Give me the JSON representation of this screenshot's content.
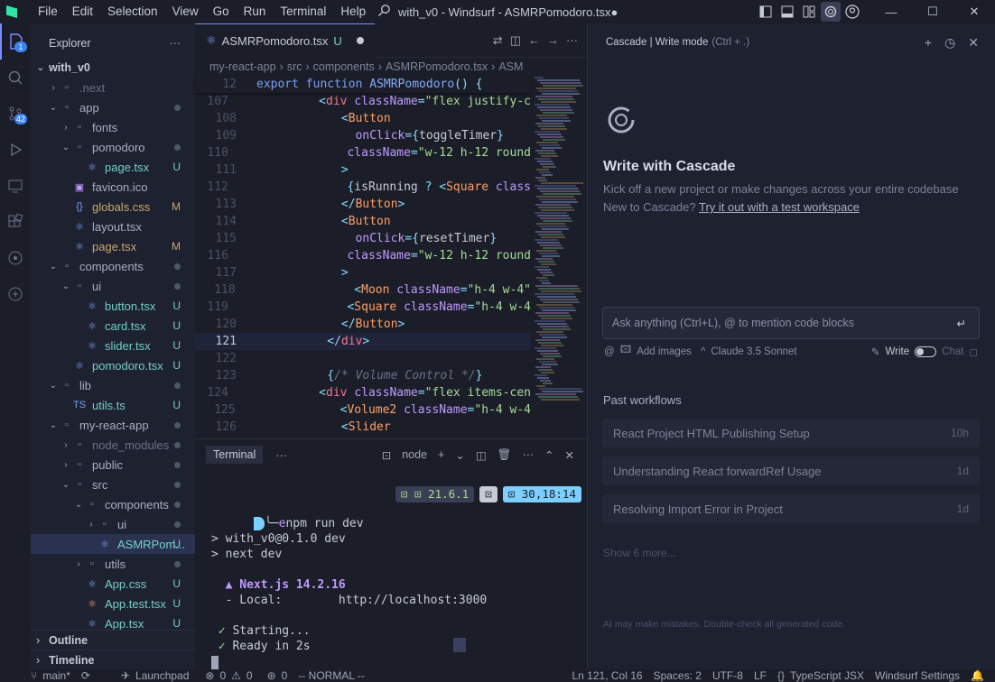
{
  "titlebar": {
    "menu": [
      "File",
      "Edit",
      "Selection",
      "View",
      "Go",
      "Run",
      "Terminal",
      "Help"
    ],
    "title": "with_v0 - Windsurf - ASMRPomodoro.tsx●"
  },
  "activity": {
    "source_control_badge": "42",
    "explorer_badge": "1"
  },
  "explorer": {
    "title": "Explorer",
    "root": "with_v0",
    "tree": [
      {
        "indent": 1,
        "chev": "›",
        "icon": "▫",
        "label": ".next",
        "status": "",
        "dim": true
      },
      {
        "indent": 1,
        "chev": "⌄",
        "icon": "▫",
        "label": "app",
        "status": "dot",
        "dim": false
      },
      {
        "indent": 2,
        "chev": "›",
        "icon": "▫",
        "label": "fonts",
        "status": "",
        "dim": false
      },
      {
        "indent": 2,
        "chev": "⌄",
        "icon": "▫",
        "label": "pomodoro",
        "status": "dot",
        "dim": false
      },
      {
        "indent": 3,
        "chev": "",
        "icon": "⚛",
        "label": "page.tsx",
        "status": "U",
        "dim": false
      },
      {
        "indent": 2,
        "chev": "",
        "icon": "▣",
        "label": "favicon.ico",
        "status": "",
        "dim": false
      },
      {
        "indent": 2,
        "chev": "",
        "icon": "{}",
        "label": "globals.css",
        "status": "M",
        "dim": false
      },
      {
        "indent": 2,
        "chev": "",
        "icon": "⚛",
        "label": "layout.tsx",
        "status": "",
        "dim": false
      },
      {
        "indent": 2,
        "chev": "",
        "icon": "⚛",
        "label": "page.tsx",
        "status": "M",
        "dim": false
      },
      {
        "indent": 1,
        "chev": "⌄",
        "icon": "▫",
        "label": "components",
        "status": "dot",
        "dim": false
      },
      {
        "indent": 2,
        "chev": "⌄",
        "icon": "▫",
        "label": "ui",
        "status": "dot",
        "dim": false
      },
      {
        "indent": 3,
        "chev": "",
        "icon": "⚛",
        "label": "button.tsx",
        "status": "U",
        "dim": false
      },
      {
        "indent": 3,
        "chev": "",
        "icon": "⚛",
        "label": "card.tsx",
        "status": "U",
        "dim": false
      },
      {
        "indent": 3,
        "chev": "",
        "icon": "⚛",
        "label": "slider.tsx",
        "status": "U",
        "dim": false
      },
      {
        "indent": 2,
        "chev": "",
        "icon": "⚛",
        "label": "pomodoro.tsx",
        "status": "U",
        "dim": false
      },
      {
        "indent": 1,
        "chev": "⌄",
        "icon": "▫",
        "label": "lib",
        "status": "dot",
        "dim": false
      },
      {
        "indent": 2,
        "chev": "",
        "icon": "TS",
        "label": "utils.ts",
        "status": "U",
        "dim": false
      },
      {
        "indent": 1,
        "chev": "⌄",
        "icon": "▫",
        "label": "my-react-app",
        "status": "dot",
        "dim": false
      },
      {
        "indent": 2,
        "chev": "›",
        "icon": "▫",
        "label": "node_modules",
        "status": "dot",
        "dim": true
      },
      {
        "indent": 2,
        "chev": "›",
        "icon": "▫",
        "label": "public",
        "status": "dot",
        "dim": false
      },
      {
        "indent": 2,
        "chev": "⌄",
        "icon": "▫",
        "label": "src",
        "status": "dot",
        "dim": false
      },
      {
        "indent": 3,
        "chev": "⌄",
        "icon": "▫",
        "label": "components",
        "status": "dot",
        "dim": false
      },
      {
        "indent": 4,
        "chev": "›",
        "icon": "▫",
        "label": "ui",
        "status": "dot",
        "dim": false
      },
      {
        "indent": 4,
        "chev": "",
        "icon": "⚛",
        "label": "ASMRPom...",
        "status": "U",
        "dim": false,
        "selected": true
      },
      {
        "indent": 3,
        "chev": "›",
        "icon": "▫",
        "label": "utils",
        "status": "dot",
        "dim": false
      },
      {
        "indent": 3,
        "chev": "",
        "icon": "⚛",
        "label": "App.css",
        "status": "U",
        "dim": false
      },
      {
        "indent": 3,
        "chev": "",
        "icon": "⚛",
        "label": "App.test.tsx",
        "status": "U",
        "dim": false
      },
      {
        "indent": 3,
        "chev": "",
        "icon": "⚛",
        "label": "App.tsx",
        "status": "U",
        "dim": false
      }
    ],
    "outline": "Outline",
    "timeline": "Timeline"
  },
  "editor": {
    "tab_label": "ASMRPomodoro.tsx",
    "tab_status": "U",
    "breadcrumb": [
      "my-react-app",
      "src",
      "components",
      "ASMRPomodoro.tsx",
      "ASM"
    ],
    "sticky": {
      "ln": "12",
      "html": "<span class='k'>export</span> <span class='k'>function</span> <span class='f'>ASMRPomodoro</span><span class='p'>()</span> <span class='p'>{</span>"
    },
    "lines": [
      {
        "ln": "107",
        "html": "          <span class='p'>&lt;</span><span class='tag'>div</span> <span class='a'>className</span><span class='p'>=</span><span class='s'>\"flex justify-c</span>"
      },
      {
        "ln": "108",
        "html": "            <span class='p'>&lt;</span><span class='t'>Button</span>"
      },
      {
        "ln": "109",
        "html": "              <span class='a'>onClick</span><span class='p'>={</span><span class='d'>toggleTimer</span><span class='p'>}</span>"
      },
      {
        "ln": "110",
        "html": "              <span class='a'>className</span><span class='p'>=</span><span class='s'>\"w-12 h-12 round</span>"
      },
      {
        "ln": "111",
        "html": "            <span class='p'>&gt;</span>"
      },
      {
        "ln": "112",
        "html": "              <span class='p'>{</span><span class='d'>isRunning</span> <span class='p'>?</span> <span class='p'>&lt;</span><span class='t'>Square</span> <span class='a'>class</span>"
      },
      {
        "ln": "113",
        "html": "            <span class='p'>&lt;/</span><span class='t'>Button</span><span class='p'>&gt;</span>"
      },
      {
        "ln": "114",
        "html": "            <span class='p'>&lt;</span><span class='t'>Button</span>"
      },
      {
        "ln": "115",
        "html": "              <span class='a'>onClick</span><span class='p'>={</span><span class='d'>resetTimer</span><span class='p'>}</span>"
      },
      {
        "ln": "116",
        "html": "              <span class='a'>className</span><span class='p'>=</span><span class='s'>\"w-12 h-12 round</span>"
      },
      {
        "ln": "117",
        "html": "            <span class='p'>&gt;</span>"
      },
      {
        "ln": "118",
        "html": "              <span class='p'>&lt;</span><span class='t'>Moon</span> <span class='a'>className</span><span class='p'>=</span><span class='s'>\"h-4 w-4\"</span>"
      },
      {
        "ln": "119",
        "html": "              <span class='p'>&lt;</span><span class='t'>Square</span> <span class='a'>className</span><span class='p'>=</span><span class='s'>\"h-4 w-4</span>"
      },
      {
        "ln": "120",
        "html": "            <span class='p'>&lt;/</span><span class='t'>Button</span><span class='p'>&gt;</span>"
      },
      {
        "ln": "121",
        "html": "          <span class='p'>&lt;/</span><span class='tag'>div</span><span class='p'>&gt;</span>",
        "current": true
      },
      {
        "ln": "122",
        "html": ""
      },
      {
        "ln": "123",
        "html": "          <span class='p'>{</span><span class='c'>/* Volume Control */</span><span class='p'>}</span>"
      },
      {
        "ln": "124",
        "html": "          <span class='p'>&lt;</span><span class='tag'>div</span> <span class='a'>className</span><span class='p'>=</span><span class='s'>\"flex items-cen</span>"
      },
      {
        "ln": "125",
        "html": "            <span class='p'>&lt;</span><span class='t'>Volume2</span> <span class='a'>className</span><span class='p'>=</span><span class='s'>\"h-4 w-4</span>"
      },
      {
        "ln": "126",
        "html": "            <span class='p'>&lt;</span><span class='t'>Slider</span>"
      }
    ]
  },
  "terminal": {
    "tab": "Terminal",
    "shell": "node",
    "seg_node_version": "21.6.1",
    "seg_time": "30,18:14",
    "prompt_cmd": "npm run dev",
    "lines": [
      {
        "text": "> with_v0@0.1.0 dev",
        "cls": ""
      },
      {
        "text": "> next dev",
        "cls": ""
      },
      {
        "text": "",
        "cls": ""
      },
      {
        "text": "  ▲ Next.js 14.2.16",
        "cls": "next"
      },
      {
        "text": "  - Local:        http://localhost:3000",
        "cls": ""
      },
      {
        "text": "",
        "cls": ""
      },
      {
        "text": " ✓ Starting...",
        "cls": "ok"
      },
      {
        "text": " ✓ Ready in 2s",
        "cls": "ok"
      }
    ]
  },
  "cascade": {
    "header": "Cascade | Write mode",
    "header_hint": "(Ctrl + .)",
    "title": "Write with Cascade",
    "subtitle1": "Kick off a new project or make changes across your entire codebase",
    "subtitle2_prefix": "New to Cascade?",
    "subtitle2_link": "Try it out with a test workspace",
    "ask_placeholder": "Ask anything (Ctrl+L), @ to mention code blocks",
    "add_images": "Add images",
    "model": "Claude 3.5 Sonnet",
    "write_label": "Write",
    "chat_label": "Chat",
    "past_title": "Past workflows",
    "workflows": [
      {
        "title": "React Project HTML Publishing Setup",
        "age": "10h"
      },
      {
        "title": "Understanding React forwardRef Usage",
        "age": "1d"
      },
      {
        "title": "Resolving Import Error in Project",
        "age": "1d"
      }
    ],
    "show_more": "Show 6 more...",
    "disclaimer": "AI may make mistakes. Double-check all generated code."
  },
  "statusbar": {
    "branch": "main*",
    "launchpad": "Launchpad",
    "errors": "0",
    "warnings": "0",
    "ports": "0",
    "mode": "-- NORMAL --",
    "position": "Ln 121, Col 16",
    "spaces": "Spaces: 2",
    "encoding": "UTF-8",
    "eol": "LF",
    "language": "TypeScript JSX",
    "settings": "Windsurf Settings"
  }
}
